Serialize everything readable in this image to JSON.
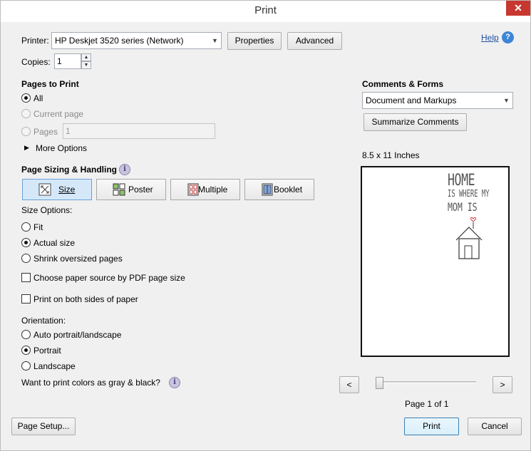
{
  "window": {
    "title": "Print",
    "close_glyph": "✕"
  },
  "printer": {
    "label": "Printer:",
    "value": "HP Deskjet 3520 series (Network)",
    "properties_label": "Properties",
    "advanced_label": "Advanced"
  },
  "copies": {
    "label": "Copies:",
    "value": "1"
  },
  "help": {
    "label": "Help",
    "icon": "?"
  },
  "pages_to_print": {
    "heading": "Pages to Print",
    "all_label": "All",
    "current_page_label": "Current page",
    "pages_label": "Pages",
    "pages_value": "1",
    "more_options_label": "More Options",
    "selected": "All"
  },
  "comments_forms": {
    "heading": "Comments & Forms",
    "value": "Document and Markups",
    "summarize_label": "Summarize Comments"
  },
  "page_sizing": {
    "heading": "Page Sizing & Handling",
    "info_glyph": "i",
    "tabs": [
      {
        "label": "Size",
        "icon": "size-icon",
        "active": true
      },
      {
        "label": "Poster",
        "icon": "poster-icon",
        "active": false
      },
      {
        "label": "Multiple",
        "icon": "multiple-icon",
        "active": false
      },
      {
        "label": "Booklet",
        "icon": "booklet-icon",
        "active": false
      }
    ]
  },
  "size_options": {
    "label": "Size Options:",
    "fit_label": "Fit",
    "actual_label": "Actual size",
    "shrink_label": "Shrink oversized pages",
    "selected": "Actual size",
    "paper_source_label": "Choose paper source by PDF page size",
    "paper_source_checked": false,
    "both_sides_label": "Print on both sides of paper",
    "both_sides_checked": false
  },
  "orientation": {
    "label": "Orientation:",
    "auto_label": "Auto portrait/landscape",
    "portrait_label": "Portrait",
    "landscape_label": "Landscape",
    "selected": "Portrait"
  },
  "gray": {
    "label": "Want to print colors as gray & black?",
    "info_glyph": "i"
  },
  "preview": {
    "size_label": "8.5 x 11 Inches",
    "doc_line1": "HOME",
    "doc_line2": "IS WHERE MY",
    "doc_line3": "MOM IS",
    "prev_glyph": "<",
    "next_glyph": ">",
    "page_status": "Page 1 of 1",
    "page_position": 1,
    "page_count": 1
  },
  "footer": {
    "page_setup_label": "Page Setup...",
    "print_label": "Print",
    "cancel_label": "Cancel"
  }
}
